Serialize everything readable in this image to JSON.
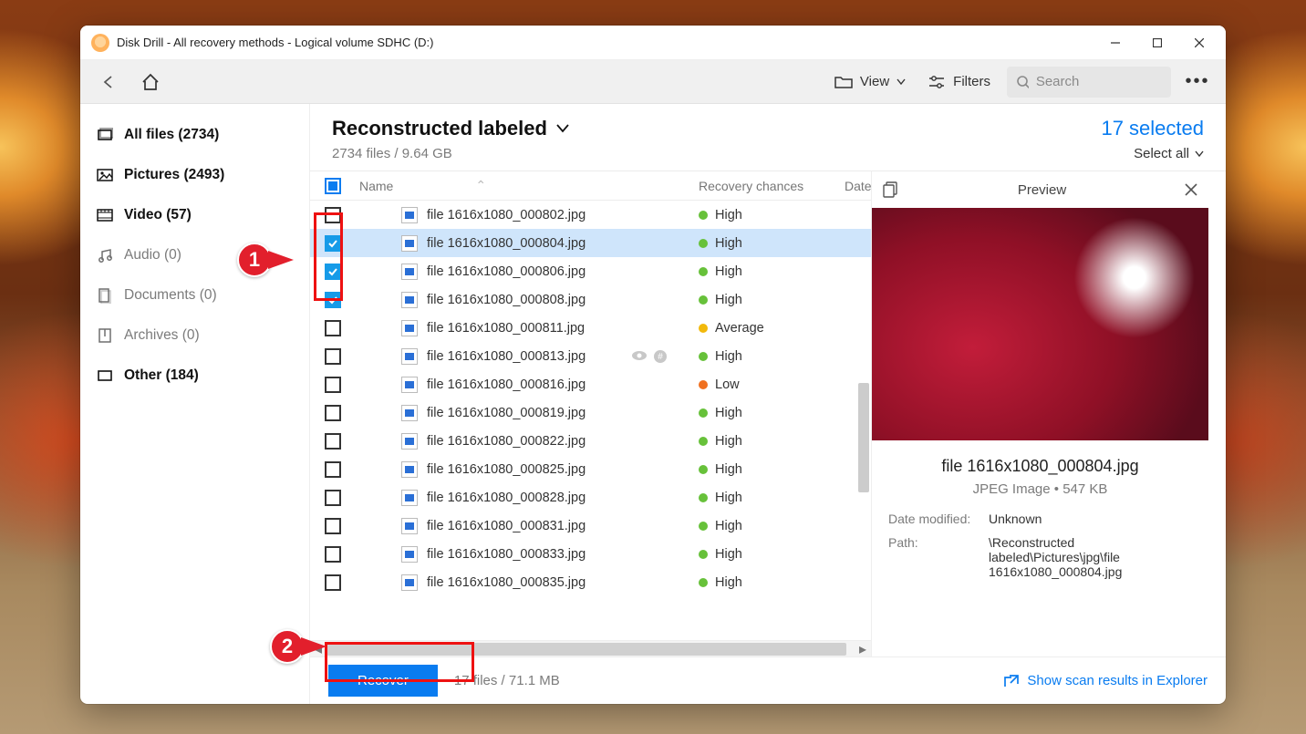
{
  "window": {
    "title": "Disk Drill - All recovery methods - Logical volume SDHC (D:)"
  },
  "toolbar": {
    "view_label": "View",
    "filters_label": "Filters",
    "search_placeholder": "Search"
  },
  "sidebar": {
    "items": [
      {
        "label": "All files (2734)",
        "icon": "stack",
        "bold": true
      },
      {
        "label": "Pictures (2493)",
        "icon": "picture",
        "bold": true
      },
      {
        "label": "Video (57)",
        "icon": "video",
        "bold": true
      },
      {
        "label": "Audio (0)",
        "icon": "audio",
        "bold": false
      },
      {
        "label": "Documents (0)",
        "icon": "document",
        "bold": false
      },
      {
        "label": "Archives (0)",
        "icon": "archive",
        "bold": false
      },
      {
        "label": "Other (184)",
        "icon": "other",
        "bold": true
      }
    ]
  },
  "main": {
    "title": "Reconstructed labeled",
    "subtitle": "2734 files / 9.64 GB",
    "selected_text": "17 selected",
    "select_all_label": "Select all"
  },
  "columns": {
    "name": "Name",
    "recovery": "Recovery chances",
    "date": "Date"
  },
  "files": [
    {
      "name": "file 1616x1080_000802.jpg",
      "chance": "High",
      "dot": "high",
      "checked": false
    },
    {
      "name": "file 1616x1080_000804.jpg",
      "chance": "High",
      "dot": "high",
      "checked": true,
      "selected": true
    },
    {
      "name": "file 1616x1080_000806.jpg",
      "chance": "High",
      "dot": "high",
      "checked": true
    },
    {
      "name": "file 1616x1080_000808.jpg",
      "chance": "High",
      "dot": "high",
      "checked": true
    },
    {
      "name": "file 1616x1080_000811.jpg",
      "chance": "Average",
      "dot": "avg",
      "checked": false
    },
    {
      "name": "file 1616x1080_000813.jpg",
      "chance": "High",
      "dot": "high",
      "checked": false,
      "show_eye": true
    },
    {
      "name": "file 1616x1080_000816.jpg",
      "chance": "Low",
      "dot": "low",
      "checked": false
    },
    {
      "name": "file 1616x1080_000819.jpg",
      "chance": "High",
      "dot": "high",
      "checked": false
    },
    {
      "name": "file 1616x1080_000822.jpg",
      "chance": "High",
      "dot": "high",
      "checked": false
    },
    {
      "name": "file 1616x1080_000825.jpg",
      "chance": "High",
      "dot": "high",
      "checked": false
    },
    {
      "name": "file 1616x1080_000828.jpg",
      "chance": "High",
      "dot": "high",
      "checked": false
    },
    {
      "name": "file 1616x1080_000831.jpg",
      "chance": "High",
      "dot": "high",
      "checked": false
    },
    {
      "name": "file 1616x1080_000833.jpg",
      "chance": "High",
      "dot": "high",
      "checked": false
    },
    {
      "name": "file 1616x1080_000835.jpg",
      "chance": "High",
      "dot": "high",
      "checked": false
    }
  ],
  "footer": {
    "recover_label": "Recover",
    "status": "17 files / 71.1 MB",
    "explorer_label": "Show scan results in Explorer"
  },
  "preview": {
    "title": "Preview",
    "filename": "file 1616x1080_000804.jpg",
    "filetype": "JPEG Image • 547 KB",
    "date_modified_label": "Date modified:",
    "date_modified": "Unknown",
    "path_label": "Path:",
    "path": "\\Reconstructed labeled\\Pictures\\jpg\\file 1616x1080_000804.jpg"
  },
  "annotations": {
    "a1": "1",
    "a2": "2"
  }
}
